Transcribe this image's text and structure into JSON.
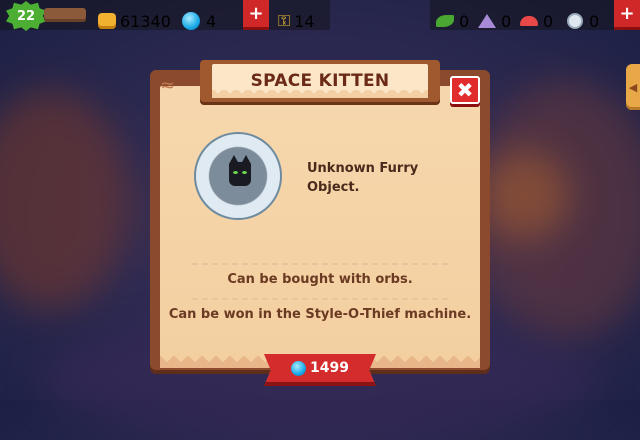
{
  "hud": {
    "level": "22",
    "gold": "61340",
    "orbs": "4",
    "keys": "14",
    "plus_label": "+",
    "resources": [
      {
        "icon": "leaf-icon",
        "count": "0"
      },
      {
        "icon": "crystal-icon",
        "count": "0"
      },
      {
        "icon": "mushroom-icon",
        "count": "0"
      },
      {
        "icon": "compass-icon",
        "count": "0"
      }
    ]
  },
  "side_tab": {
    "arrow": "◀"
  },
  "dialog": {
    "title": "SPACE KITTEN",
    "close_label": "✖",
    "description": "Unknown Furry Object.",
    "line1": "Can be bought with orbs.",
    "line2": "Can be won in the Style-O-Thief machine.",
    "price": "1499"
  },
  "colors": {
    "accent_red": "#d42c2c",
    "panel": "#f6d7ad",
    "wood": "#8b4a2e",
    "text_brown": "#6b3a22"
  }
}
